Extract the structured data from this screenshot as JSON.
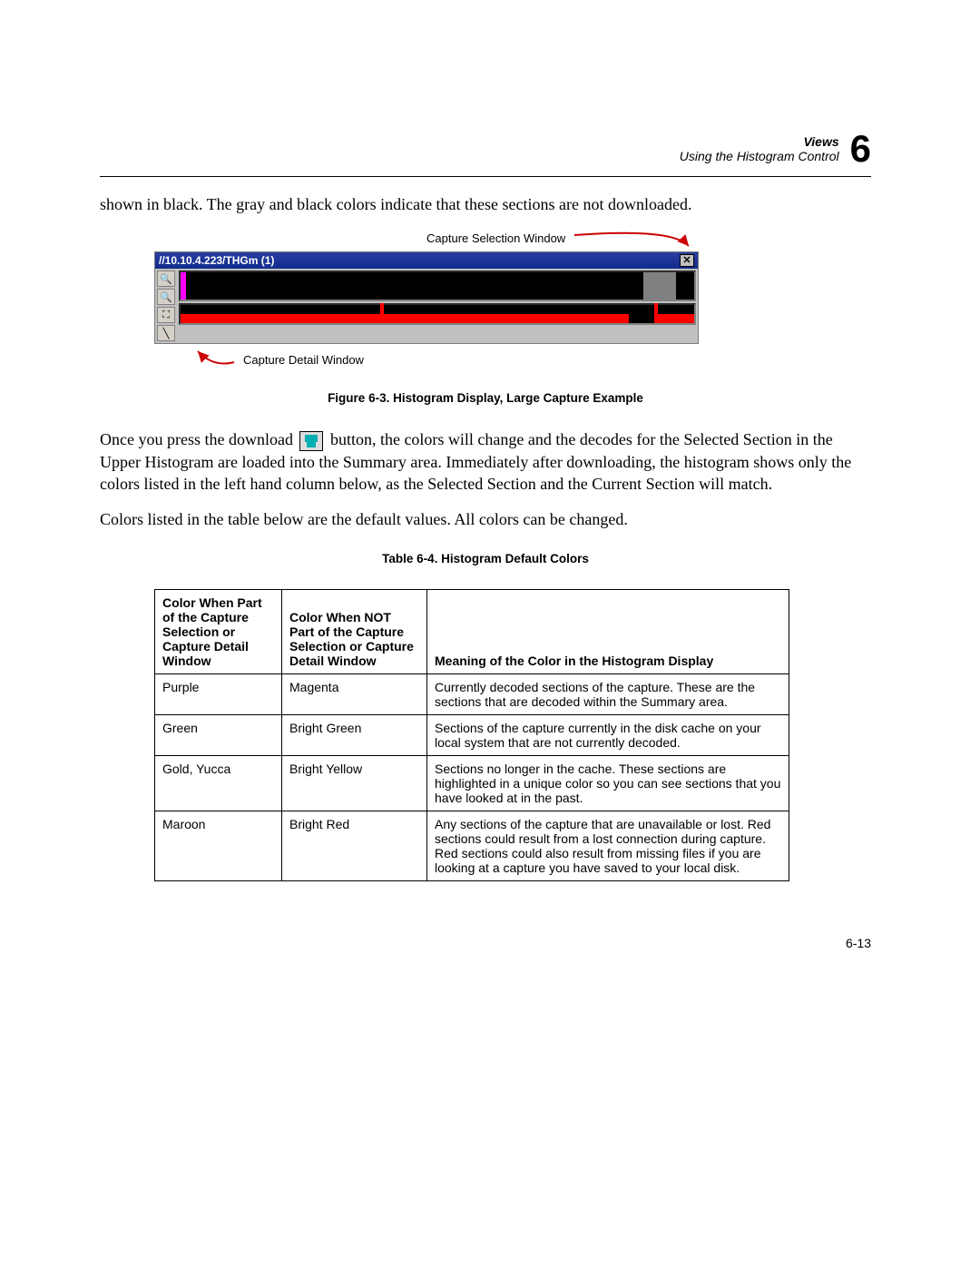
{
  "header": {
    "section": "Views",
    "subsection": "Using the Histogram Control",
    "chapter_number": "6"
  },
  "paragraphs": {
    "p1": "shown in black. The gray and black colors indicate that these sections are not downloaded.",
    "callout_selection": "Capture Selection Window",
    "window_title": "//10.10.4.223/THGm (1)",
    "close_glyph": "✕",
    "callout_detail": "Capture Detail Window",
    "figcap": "Figure 6-3.  Histogram Display, Large Capture Example",
    "p2a": "Once you press the download ",
    "p2b": " button, the colors will change and the decodes for the Selected Section in the Upper Histogram are loaded into the Summary area. Immediately after downloading, the histogram shows only the colors listed in the left hand column below, as the Selected Section and the Current Section will match.",
    "p3": "Colors listed in the table below are the default values. All colors can be changed.",
    "tblcap": "Table 6-4. Histogram Default Colors"
  },
  "toolbar": {
    "zoom_in": "🔍",
    "zoom_out": "🔍",
    "fit": "⛶",
    "line": "╲"
  },
  "table": {
    "headers": {
      "h1": "Color When Part of the Capture Selection or Capture Detail Window",
      "h2": "Color When NOT Part of the Capture Selection or Capture Detail Window",
      "h3": "Meaning of the Color in the Histogram Display"
    },
    "rows": [
      {
        "c1": "Purple",
        "c2": "Magenta",
        "c3": "Currently decoded sections of the capture. These are the sections that are decoded within the Summary area."
      },
      {
        "c1": "Green",
        "c2": "Bright Green",
        "c3": "Sections of the capture currently in the disk cache on your local system that are not currently decoded."
      },
      {
        "c1": "Gold, Yucca",
        "c2": "Bright Yellow",
        "c3": "Sections no longer in the cache. These sections are highlighted in a unique color so you can see sections that you have looked at in the past."
      },
      {
        "c1": "Maroon",
        "c2": "Bright Red",
        "c3": "Any sections of the capture that are unavailable or lost. Red sections could result from a lost connection during capture. Red sections could also result from missing files if you are looking at a capture you have saved to your local disk."
      }
    ]
  },
  "page_number": "6-13"
}
